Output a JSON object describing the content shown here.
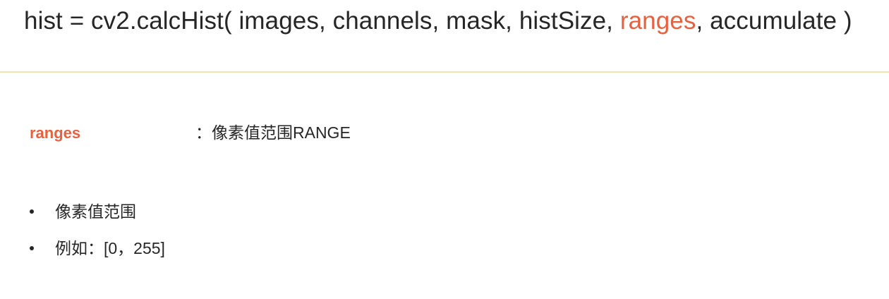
{
  "signature": {
    "prefix": "hist = cv2.calcHist( images, channels, mask, histSize, ",
    "highlight": "ranges",
    "suffix": ", accumulate )"
  },
  "param": {
    "name": "ranges",
    "description": "：像素值范围RANGE"
  },
  "bullets": [
    "像素值范围",
    "例如：[0，255]"
  ],
  "colors": {
    "accent": "#e7613e",
    "text": "#262626",
    "divider": "#fbe3b0"
  }
}
